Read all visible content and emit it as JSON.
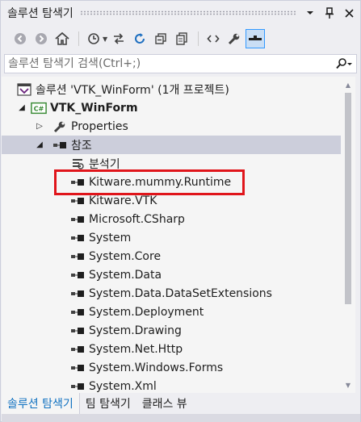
{
  "window": {
    "title": "솔루션 탐색기",
    "dropdown_icon": "chevron-down-icon",
    "pin_icon": "pin-icon",
    "close_icon": "close-icon"
  },
  "toolbar": {
    "buttons": [
      "back-icon",
      "forward-icon",
      "home-icon",
      "history-icon",
      "sync-icon",
      "refresh-icon",
      "collapse-all-icon",
      "copy-icon",
      "code-icon",
      "properties-icon",
      "preview-icon"
    ]
  },
  "search": {
    "placeholder": "솔루션 탐색기 검색(Ctrl+;)"
  },
  "tree": {
    "solution": "솔루션 'VTK_WinForm' (1개 프로젝트)",
    "project": "VTK_WinForm",
    "project_badge": "C#",
    "properties": "Properties",
    "references": "참조",
    "items": [
      "분석기",
      "Kitware.mummy.Runtime",
      "Kitware.VTK",
      "Microsoft.CSharp",
      "System",
      "System.Core",
      "System.Data",
      "System.Data.DataSetExtensions",
      "System.Deployment",
      "System.Drawing",
      "System.Net.Http",
      "System.Windows.Forms",
      "System.Xml"
    ]
  },
  "tabs": [
    "솔루션 탐색기",
    "팀 탐색기",
    "클래스 뷰"
  ],
  "colors": {
    "accent": "#0e70c0",
    "highlight_border": "#e0151b",
    "selected_row": "#cccedb"
  }
}
